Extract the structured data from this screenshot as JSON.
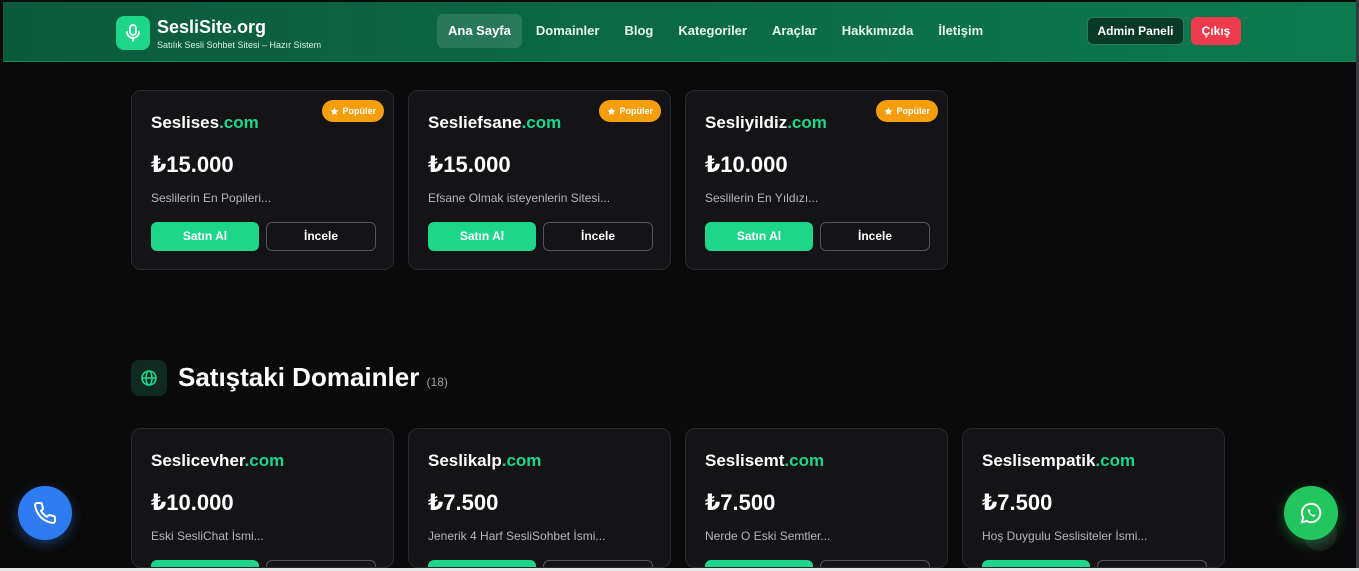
{
  "header": {
    "brand_title": "SesliSite.org",
    "brand_subtitle": "Satılık Sesli Sohbet Sitesi – Hazır Sistem",
    "nav": [
      {
        "label": "Ana Sayfa",
        "active": true
      },
      {
        "label": "Domainler"
      },
      {
        "label": "Blog"
      },
      {
        "label": "Kategoriler"
      },
      {
        "label": "Araçlar"
      },
      {
        "label": "Hakkımızda"
      },
      {
        "label": "İletişim"
      }
    ],
    "admin_label": "Admin Paneli",
    "logout_label": "Çıkış"
  },
  "popular_cards": [
    {
      "name": "Seslises",
      "tld": ".com",
      "price": "₺15.000",
      "desc": "Seslilerin En Popileri...",
      "badge": "Popüler",
      "buy": "Satın Al",
      "view": "İncele"
    },
    {
      "name": "Sesliefsane",
      "tld": ".com",
      "price": "₺15.000",
      "desc": "Efsane Olmak isteyenlerin Sitesi...",
      "badge": "Popüler",
      "buy": "Satın Al",
      "view": "İncele"
    },
    {
      "name": "Sesliyildiz",
      "tld": ".com",
      "price": "₺10.000",
      "desc": "Seslilerin En Yıldızı...",
      "badge": "Popüler",
      "buy": "Satın Al",
      "view": "İncele"
    }
  ],
  "section": {
    "title": "Satıştaki Domainler",
    "count": "(18)"
  },
  "sale_cards": [
    {
      "name": "Seslicevher",
      "tld": ".com",
      "price": "₺10.000",
      "desc": "Eski SesliChat İsmi..."
    },
    {
      "name": "Seslikalp",
      "tld": ".com",
      "price": "₺7.500",
      "desc": "Jenerik 4 Harf SesliSohbet İsmi..."
    },
    {
      "name": "Seslisemt",
      "tld": ".com",
      "price": "₺7.500",
      "desc": "Nerde O Eski Semtler..."
    },
    {
      "name": "Seslisempatik",
      "tld": ".com",
      "price": "₺7.500",
      "desc": "Hoş Duygulu Seslisiteler İsmi..."
    }
  ],
  "colors": {
    "accent": "#1ed68a",
    "header": "#0b6845",
    "badge": "#f59e0b",
    "danger": "#ee3b4d",
    "phone": "#2f7cf0",
    "whatsapp": "#22c55e"
  },
  "icons": {
    "brand": "microphone-icon",
    "section": "globe-icon",
    "badge": "star-icon",
    "fab_left": "phone-icon",
    "fab_right": "whatsapp-icon"
  }
}
